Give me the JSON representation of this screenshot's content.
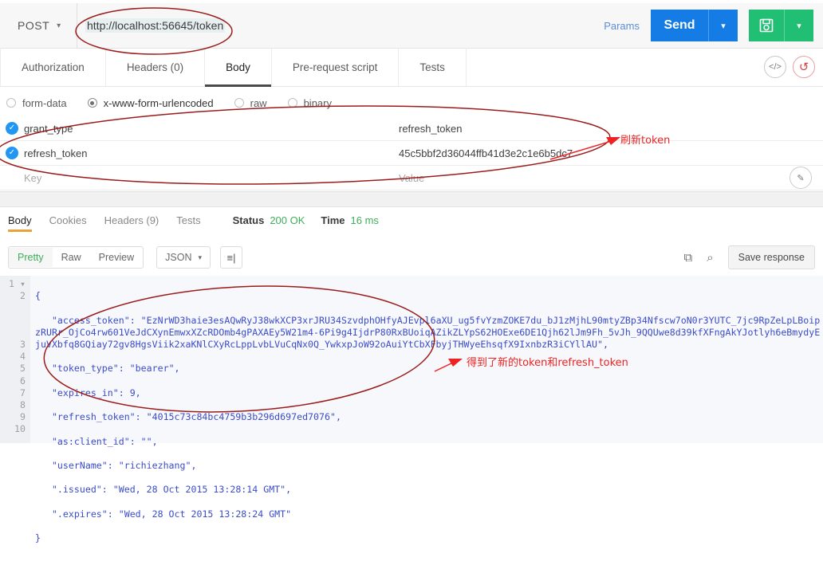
{
  "request": {
    "method": "POST",
    "method_caret": "▾",
    "url": "http://localhost:56645/token",
    "params_label": "Params",
    "send_label": "Send",
    "send_caret": "▾",
    "save_icon": "save-disk-icon",
    "save_caret": "▾",
    "tabs": [
      {
        "label": "Authorization",
        "active": false
      },
      {
        "label": "Headers (0)",
        "active": false
      },
      {
        "label": "Body",
        "active": true
      },
      {
        "label": "Pre-request script",
        "active": false
      },
      {
        "label": "Tests",
        "active": false
      }
    ],
    "tab_icons": [
      {
        "name": "code-icon",
        "glyph": "</>"
      },
      {
        "name": "reset-icon",
        "glyph": "↺"
      }
    ],
    "body_types": [
      {
        "label": "form-data",
        "selected": false
      },
      {
        "label": "x-www-form-urlencoded",
        "selected": true
      },
      {
        "label": "raw",
        "selected": false
      },
      {
        "label": "binary",
        "selected": false
      }
    ],
    "kv_rows": [
      {
        "checked": true,
        "key": "grant_type",
        "value": "refresh_token",
        "placeholder": false
      },
      {
        "checked": true,
        "key": "refresh_token",
        "value": "45c5bbf2d36044ffb41d3e2c1e6b5dc7",
        "placeholder": false
      },
      {
        "checked": false,
        "key": "Key",
        "value": "Value",
        "placeholder": true
      }
    ],
    "edit_icon": "pencil-icon"
  },
  "response": {
    "tabs": [
      {
        "label": "Body",
        "active": true
      },
      {
        "label": "Cookies",
        "active": false
      },
      {
        "label": "Headers (9)",
        "active": false
      },
      {
        "label": "Tests",
        "active": false
      }
    ],
    "status_label": "Status",
    "status_value": "200 OK",
    "time_label": "Time",
    "time_value": "16 ms",
    "view_modes": [
      {
        "label": "Pretty",
        "active": true
      },
      {
        "label": "Raw",
        "active": false
      },
      {
        "label": "Preview",
        "active": false
      }
    ],
    "format": "JSON",
    "format_caret": "▾",
    "wrap_icon": "wrap-lines-icon",
    "copy_icon": "copy-icon",
    "search_icon": "search-icon",
    "save_response_label": "Save response",
    "line_numbers": [
      "1",
      "2",
      "3",
      "4",
      "5",
      "6",
      "7",
      "8",
      "9",
      "10"
    ],
    "json": {
      "access_token": "EzNrWD3haie3esAQwRyJ38wkXCP3xrJRU34SzvdphOHfyAJEvpl6aXU_ug5fvYzmZOKE7du_bJ1zMjhL90mtyZBp34Nfscw7oN0r3YUTC_7jc9RpZeLpLBoipzRURr_OjCo4rw601VeJdCXynEmwxXZcRDOmb4gPAXAEy5W21m4-6Pi9g4IjdrP80RxBUoiqAZikZLYpS62HOExe6DE1Qjh62lJm9Fh_5vJh_9QQUwe8d39kfXFngAkYJotlyh6eBmydyEjuVXbfq8GQiay72gv8HgsViik2xaKNlCXyRcLppLvbLVuCqNx0Q_YwkxpJoW92oAuiYtCbXFbyjTHWyeEhsqfX9IxnbzR3iCYllAU",
      "token_type": "bearer",
      "expires_in": "9",
      "refresh_token": "4015c73c84bc4759b3b296d697ed7076",
      "as_client_id": "",
      "userName": "richiezhang",
      "issued": "Wed, 28 Oct 2015 13:28:14 GMT",
      "expires": "Wed, 28 Oct 2015 13:28:24 GMT"
    },
    "json_keys": {
      "access_token": "\"access_token\"",
      "token_type": "\"token_type\"",
      "expires_in": "\"expires_in\"",
      "refresh_token": "\"refresh_token\"",
      "as_client_id": "\"as:client_id\"",
      "userName": "\"userName\"",
      "issued": "\".issued\"",
      "expires": "\".expires\""
    }
  },
  "annotations": [
    {
      "name": "refresh-token-note",
      "text": "刷新token",
      "color": "#ee2222"
    },
    {
      "name": "new-token-note",
      "text": "得到了新的token和refresh_token",
      "color": "#ee2222"
    }
  ],
  "colors": {
    "send_blue": "#147ce4",
    "save_green": "#21bf73",
    "status_green": "#3fae5a",
    "annotation_red": "#ee2222",
    "active_tab_underline": "#4a4a4a",
    "response_tab_underline": "#e8a33d",
    "code_text": "#3b4cca"
  }
}
